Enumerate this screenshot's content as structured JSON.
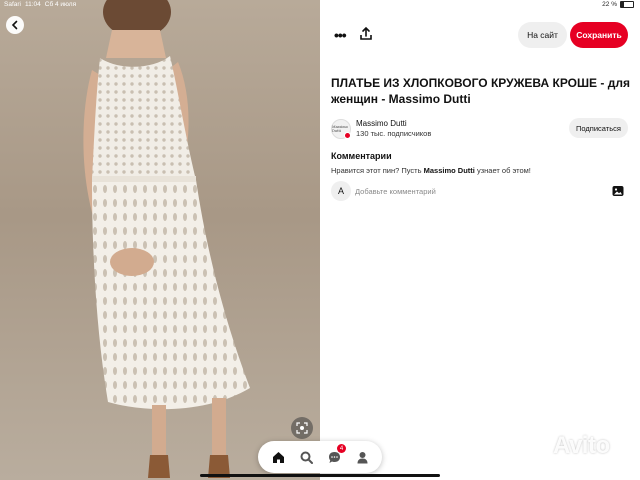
{
  "status_bar": {
    "app": "Safari",
    "time": "11:04",
    "date": "Сб 4 июля",
    "battery": "22 %"
  },
  "pin": {
    "title": "ПЛАТЬЕ ИЗ ХЛОПКОВОГО КРУЖЕВА КРОШЕ - для женщин -  Massimo Dutti",
    "image_description": "white crochet lace dress"
  },
  "header": {
    "more_label": "•••",
    "visit_label": "На сайт",
    "save_label": "Сохранить"
  },
  "creator": {
    "name": "Massimo Dutti",
    "followers": "130 тыс. подписчиков",
    "avatar_text": "Massimo Dutti",
    "subscribe_label": "Подписаться"
  },
  "comments": {
    "heading": "Комментарии",
    "prompt_before": "Нравится этот пин? Пусть ",
    "prompt_brand": "Massimo Dutti",
    "prompt_after": " узнает об этом!",
    "user_initial": "A",
    "placeholder": "Добавьте комментарий"
  },
  "nav": {
    "notifications_count": "4"
  },
  "watermark": {
    "text": "Avito"
  },
  "colors": {
    "accent": "#e60023"
  },
  "icons": {
    "back": "chevron-left-icon",
    "visual_search": "lens-icon",
    "home": "home-icon",
    "search": "search-icon",
    "messages": "chat-icon",
    "profile": "person-icon",
    "share": "share-icon",
    "photo": "image-icon"
  }
}
